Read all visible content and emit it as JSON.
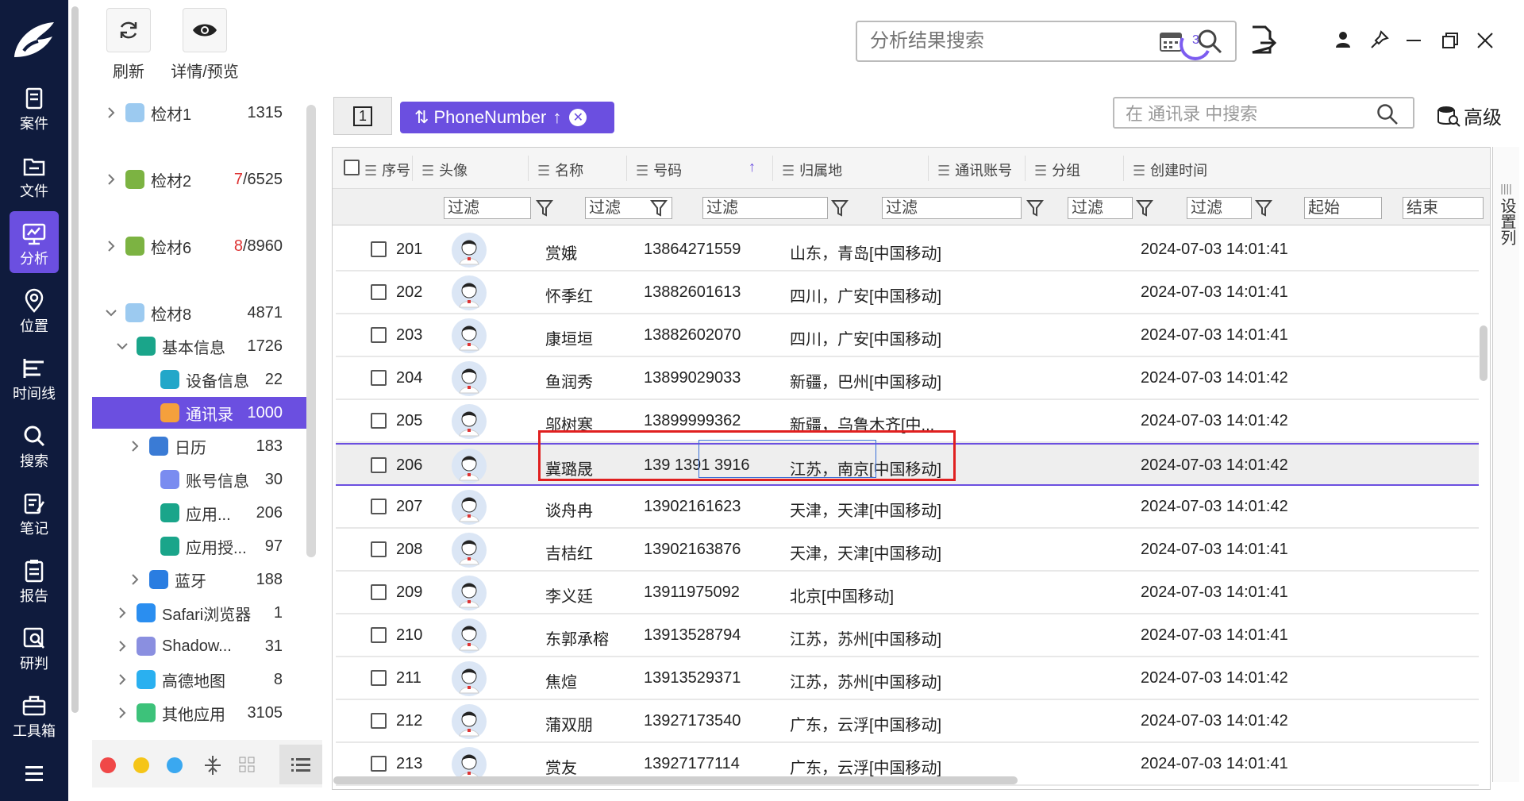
{
  "sidebar": {
    "items": [
      {
        "label": "案件",
        "icon": "case-icon"
      },
      {
        "label": "文件",
        "icon": "folder-icon"
      },
      {
        "label": "分析",
        "icon": "analysis-icon",
        "active": true
      },
      {
        "label": "位置",
        "icon": "location-icon"
      },
      {
        "label": "时间线",
        "icon": "timeline-icon"
      },
      {
        "label": "搜索",
        "icon": "search-icon"
      },
      {
        "label": "笔记",
        "icon": "notes-icon"
      },
      {
        "label": "报告",
        "icon": "report-icon"
      },
      {
        "label": "研判",
        "icon": "judge-icon"
      },
      {
        "label": "工具箱",
        "icon": "toolbox-icon"
      }
    ]
  },
  "toolbar": {
    "refresh_label": "刷新",
    "detail_label": "详情/预览",
    "search_placeholder": "分析结果搜索",
    "task_count": "3"
  },
  "tree": {
    "items": [
      {
        "label": "检材1",
        "count": "1315",
        "icon": "apple-icon"
      },
      {
        "label": "检材2",
        "count_red": "7",
        "count": "/6525",
        "icon": "android-icon"
      },
      {
        "label": "检材6",
        "count_red": "8",
        "count": "/8960",
        "icon": "android-icon"
      },
      {
        "label": "检材8",
        "count": "4871",
        "icon": "apple-icon"
      },
      {
        "label": "基本信息",
        "count": "1726",
        "icon": "info-icon"
      },
      {
        "label": "设备信息",
        "count": "22",
        "icon": "device-icon"
      },
      {
        "label": "通讯录",
        "count": "1000",
        "icon": "contacts-icon"
      },
      {
        "label": "日历",
        "count": "183",
        "icon": "calendar-icon"
      },
      {
        "label": "账号信息",
        "count": "30",
        "icon": "account-icon"
      },
      {
        "label": "应用...",
        "count": "206",
        "icon": "app-list-icon"
      },
      {
        "label": "应用授...",
        "count": "97",
        "icon": "app-auth-icon"
      },
      {
        "label": "蓝牙",
        "count": "188",
        "icon": "bluetooth-icon"
      },
      {
        "label": "Safari浏览器",
        "count": "1",
        "icon": "safari-icon"
      },
      {
        "label": "Shadow...",
        "count": "31",
        "icon": "rocket-icon"
      },
      {
        "label": "高德地图",
        "count": "8",
        "icon": "amap-icon"
      },
      {
        "label": "其他应用",
        "count": "3105",
        "icon": "other-app-icon"
      }
    ]
  },
  "main": {
    "tab_number": "1",
    "sort_chip": "PhoneNumber",
    "search_placeholder": "在 通讯录 中搜索",
    "advanced_label": "高级",
    "settings_label": "设置列",
    "columns": [
      "序号",
      "头像",
      "名称",
      "号码",
      "归属地",
      "通讯账号",
      "分组",
      "创建时间"
    ],
    "filter_placeholder": "过滤",
    "date_start": "起始",
    "date_end": "结束",
    "rows": [
      {
        "no": "201",
        "name": "赏娥",
        "phone": "13864271559",
        "loc": "山东，青岛[中国移动]",
        "time": "2024-07-03 14:01:41"
      },
      {
        "no": "202",
        "name": "怀季红",
        "phone": "13882601613",
        "loc": "四川，广安[中国移动]",
        "time": "2024-07-03 14:01:41"
      },
      {
        "no": "203",
        "name": "康垣垣",
        "phone": "13882602070",
        "loc": "四川，广安[中国移动]",
        "time": "2024-07-03 14:01:41"
      },
      {
        "no": "204",
        "name": "鱼润秀",
        "phone": "13899029033",
        "loc": "新疆，巴州[中国移动]",
        "time": "2024-07-03 14:01:42"
      },
      {
        "no": "205",
        "name": "邬树寒",
        "phone": "13899999362",
        "loc": "新疆，乌鲁木齐[中...",
        "time": "2024-07-03 14:01:42"
      },
      {
        "no": "206",
        "name": "冀璐晟",
        "phone": "139 1391 3916",
        "loc": "江苏，南京[中国移动]",
        "time": "2024-07-03 14:01:42"
      },
      {
        "no": "207",
        "name": "谈舟冉",
        "phone": "13902161623",
        "loc": "天津，天津[中国移动]",
        "time": "2024-07-03 14:01:42"
      },
      {
        "no": "208",
        "name": "吉桔红",
        "phone": "13902163876",
        "loc": "天津，天津[中国移动]",
        "time": "2024-07-03 14:01:41"
      },
      {
        "no": "209",
        "name": "李义廷",
        "phone": "13911975092",
        "loc": "北京[中国移动]",
        "time": "2024-07-03 14:01:41"
      },
      {
        "no": "210",
        "name": "东郭承榕",
        "phone": "13913528794",
        "loc": "江苏，苏州[中国移动]",
        "time": "2024-07-03 14:01:41"
      },
      {
        "no": "211",
        "name": "焦煊",
        "phone": "13913529371",
        "loc": "江苏，苏州[中国移动]",
        "time": "2024-07-03 14:01:42"
      },
      {
        "no": "212",
        "name": "蒲双朋",
        "phone": "13927173540",
        "loc": "广东，云浮[中国移动]",
        "time": "2024-07-03 14:01:42"
      },
      {
        "no": "213",
        "name": "赏友",
        "phone": "13927177114",
        "loc": "广东，云浮[中国移动]",
        "time": "2024-07-03 14:01:41"
      }
    ]
  }
}
